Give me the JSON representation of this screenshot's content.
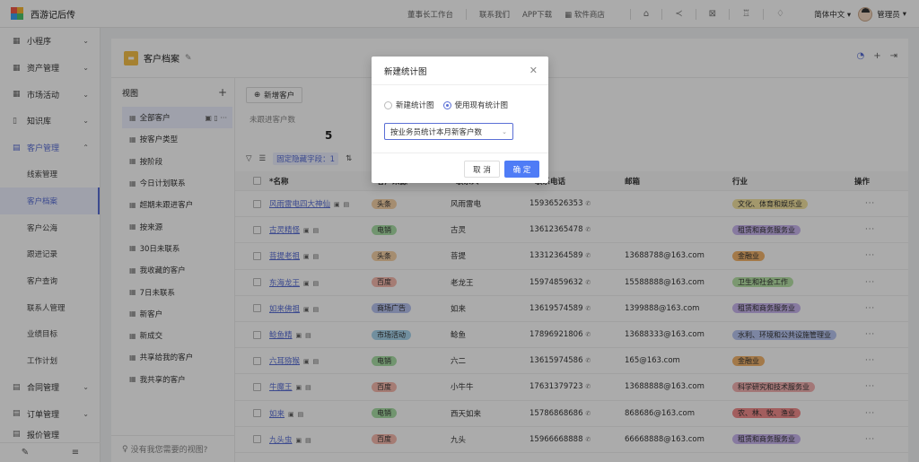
{
  "app": {
    "title": "西游记后传"
  },
  "topnav": {
    "items": [
      "董事长工作台",
      "联系我们",
      "APP下载",
      "软件商店"
    ],
    "language": "简体中文",
    "user": "管理员"
  },
  "sidebar": {
    "groups_top": [
      {
        "label": "小程序",
        "icon": "grid-icon"
      },
      {
        "label": "资产管理",
        "icon": "grid-icon"
      },
      {
        "label": "市场活动",
        "icon": "grid-icon"
      },
      {
        "label": "知识库",
        "icon": "book-icon"
      },
      {
        "label": "客户管理",
        "icon": "doc-icon"
      }
    ],
    "sub_items": [
      "线索管理",
      "客户档案",
      "客户公海",
      "跟进记录",
      "客户查询",
      "联系人管理",
      "业绩目标",
      "工作计划"
    ],
    "active_sub": "客户档案",
    "groups_bottom": [
      {
        "label": "合同管理",
        "icon": "doc-icon"
      },
      {
        "label": "订单管理",
        "icon": "doc-icon"
      },
      {
        "label": "报价管理",
        "icon": "doc-icon"
      }
    ]
  },
  "page": {
    "title": "客户档案"
  },
  "views": {
    "heading": "视图",
    "items": [
      "全部客户",
      "按客户类型",
      "按阶段",
      "今日计划联系",
      "超期未跟进客户",
      "按来源",
      "30日未联系",
      "我收藏的客户",
      "7日未联系",
      "新客户",
      "新成交",
      "共享给我的客户",
      "我共享的客户"
    ],
    "active": "全部客户",
    "footer": "没有我您需要的视图?"
  },
  "content": {
    "add_button": "新增客户",
    "stat_label": "未跟进客户数",
    "stat_value": "5",
    "filter_tag": "固定隐藏字段：1",
    "columns": [
      "名称",
      "客户来源",
      "联系人",
      "联系电话",
      "邮箱",
      "行业",
      "操作"
    ],
    "rows": [
      {
        "name": "风雨雷电四大神仙",
        "source": "头条",
        "contact": "风雨雷电",
        "phone": "15936526353",
        "email": "",
        "industry": "文化、体育和娱乐业"
      },
      {
        "name": "古灵精怪",
        "source": "电销",
        "contact": "古灵",
        "phone": "13612365478",
        "email": "",
        "industry": "租赁和商务服务业"
      },
      {
        "name": "菩提老祖",
        "source": "头条",
        "contact": "菩提",
        "phone": "13312364589",
        "email": "13688788@163.com",
        "industry": "金融业"
      },
      {
        "name": "东海龙王",
        "source": "百度",
        "contact": "老龙王",
        "phone": "15974859632",
        "email": "15588888@163.com",
        "industry": "卫生和社会工作"
      },
      {
        "name": "如来佛祖",
        "source": "商场广告",
        "contact": "如来",
        "phone": "13619574589",
        "email": "1399888@163.com",
        "industry": "租赁和商务服务业"
      },
      {
        "name": "鲶鱼精",
        "source": "市场活动",
        "contact": "鲶鱼",
        "phone": "17896921806",
        "email": "13688333@163.com",
        "industry": "水利、环境和公共设施管理业"
      },
      {
        "name": "六耳猕猴",
        "source": "电销",
        "contact": "六二",
        "phone": "13615974586",
        "email": "165@163.com",
        "industry": "金融业"
      },
      {
        "name": "牛魔王",
        "source": "百度",
        "contact": "小牛牛",
        "phone": "17631379723",
        "email": "13688888@163.com",
        "industry": "科学研究和技术服务业"
      },
      {
        "name": "如来",
        "source": "电销",
        "contact": "西天如来",
        "phone": "15786868686",
        "email": "868686@163.com",
        "industry": "农、林、牧、渔业"
      },
      {
        "name": "九头虫",
        "source": "百度",
        "contact": "九头",
        "phone": "15966668888",
        "email": "66668888@163.com",
        "industry": "租赁和商务服务业"
      }
    ],
    "colors": {
      "头条": "#f6d2a8",
      "电销": "#a9dfa6",
      "百度": "#f6b9ae",
      "商场广告": "#b8c3f0",
      "市场活动": "#a9d6ee",
      "文化、体育和娱乐业": "#f3e3a1",
      "租赁和商务服务业": "#c9b6ef",
      "金融业": "#f3b56e",
      "卫生和社会工作": "#b8e3a7",
      "水利、环境和公共设施管理业": "#b9c7f2",
      "科学研究和技术服务业": "#f4b2b2",
      "农、林、牧、渔业": "#f28c8c"
    }
  },
  "modal": {
    "title": "新建统计图",
    "radio_new": "新建统计图",
    "radio_existing": "使用现有统计图",
    "select_value": "按业务员统计本月新客户数",
    "cancel": "取 消",
    "ok": "确 定"
  }
}
